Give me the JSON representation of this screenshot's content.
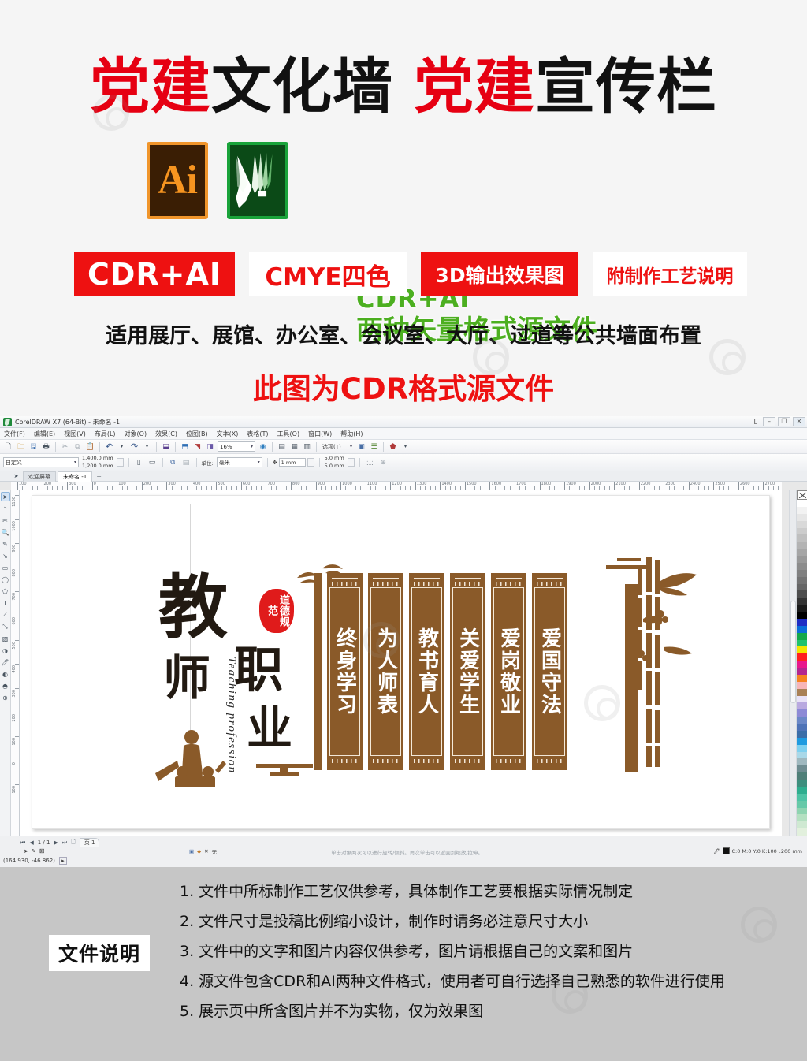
{
  "promo": {
    "title_parts": [
      {
        "text": "党建",
        "color": "#e60012"
      },
      {
        "text": "文化墙",
        "color": "#111111"
      },
      {
        "text": "党建",
        "color": "#e60012"
      },
      {
        "text": "宣传栏",
        "color": "#111111"
      }
    ],
    "ai_icon_label": "Ai",
    "cdr_icon_label": "CorelDRAW",
    "format_line1": "CDR+AI",
    "format_line2": "两种矢量格式源文件",
    "format_color": "#4caf20",
    "badges": [
      {
        "label": "CDR+AI",
        "style": "filled"
      },
      {
        "label": "CMYE四色",
        "style": "hollow"
      },
      {
        "label": "3D输出效果图",
        "style": "filled"
      },
      {
        "label": "附制作工艺说明",
        "style": "hollow"
      }
    ],
    "applies_text": "适用展厅、展馆、办公室、会议室、大厅、过道等公共墙面布置",
    "source_note": "此图为CDR格式源文件",
    "red": "#ee1111"
  },
  "coreldraw": {
    "window_title": "CorelDRAW X7 (64-Bit) - 未命名 -1",
    "user_label": "L",
    "win_buttons": [
      "–",
      "❐",
      "✕"
    ],
    "menu": [
      "文件(F)",
      "编辑(E)",
      "视图(V)",
      "布局(L)",
      "对象(O)",
      "效果(C)",
      "位图(B)",
      "文本(X)",
      "表格(T)",
      "工具(O)",
      "窗口(W)",
      "帮助(H)"
    ],
    "toolbar_icons": [
      "new-icon",
      "open-icon",
      "save-icon",
      "print-icon",
      "cut-icon",
      "copy-icon",
      "paste-icon",
      "undo-icon",
      "redo-icon",
      "import-icon",
      "export-icon",
      "publish-pdf-icon",
      "app-launch-icon"
    ],
    "zoom_level": "16%",
    "options_label": "选项(T)",
    "propbar": {
      "page_preset": "自定义",
      "page_width": "1,400.0 mm",
      "page_height": "1,200.0 mm",
      "units_label": "单位:",
      "units_value": "毫米",
      "nudge_value": "1 mm",
      "duplicate_x": "5.0 mm",
      "duplicate_y": "5.0 mm"
    },
    "tabs": [
      {
        "label": "欢迎屏幕",
        "active": false
      },
      {
        "label": "未命名 -1",
        "active": true
      }
    ],
    "tab_add": "+",
    "ruler_h_labels": [
      "100",
      "200",
      "300",
      "0",
      "100",
      "200",
      "300",
      "400",
      "500",
      "600",
      "700",
      "800",
      "900",
      "1000",
      "1100",
      "1200",
      "1300",
      "1400",
      "1500",
      "1600",
      "1700",
      "1800",
      "1900",
      "2000",
      "2100",
      "2200",
      "2300",
      "2400",
      "2500",
      "2600",
      "2700"
    ],
    "ruler_v_labels": [
      "1100",
      "1000",
      "900",
      "800",
      "700",
      "600",
      "500",
      "400",
      "300",
      "200",
      "100",
      "0",
      "100"
    ],
    "toolbox": [
      "pick-tool-icon",
      "shape-tool-icon",
      "crop-tool-icon",
      "zoom-tool-icon",
      "freehand-tool-icon",
      "artistic-media-icon",
      "rectangle-tool-icon",
      "ellipse-tool-icon",
      "polygon-tool-icon",
      "text-tool-icon",
      "parallel-dimension-icon",
      "straight-line-connector-icon",
      "drop-shadow-icon",
      "transparency-icon",
      "color-eyedropper-icon",
      "interactive-fill-icon",
      "smart-fill-icon",
      "add-tool-icon"
    ],
    "status": {
      "page_current": "1 / 1",
      "page_tab": "页 1",
      "coords": "(164.930, -46.862)",
      "hint": "单击对象两次可以进行旋转/倾斜。再次单击可以返回到缩放/拉伸。",
      "snap_label": "无",
      "fill_info": "C:0 M:0 Y:0 K:100",
      "outline_info": ".200 mm"
    },
    "palette_colors": [
      "#ffffff",
      "#f2f2f2",
      "#e6e6e6",
      "#d9d9d9",
      "#cccccc",
      "#bfbfbf",
      "#b3b3b3",
      "#a6a6a6",
      "#999999",
      "#8c8c8c",
      "#808080",
      "#737373",
      "#666666",
      "#4d4d4d",
      "#333333",
      "#1a1a1a",
      "#000000",
      "#1f2ec4",
      "#0b6ed8",
      "#14a84a",
      "#1fc36d",
      "#f2e500",
      "#ff1f1f",
      "#e8178c",
      "#b3268f",
      "#f58220",
      "#f7b5b8",
      "#a98156",
      "#e8e2f7",
      "#b9a9e0",
      "#8d8ad6",
      "#6b88c7",
      "#4e73b7",
      "#3b6ea8",
      "#1f9be0",
      "#7fd0ef",
      "#a9d8e8",
      "#9fb8bf",
      "#6e8c91",
      "#4f7f78",
      "#3d8f7e",
      "#2fae8f",
      "#4fc3a5",
      "#66c9a8",
      "#8fd4b1",
      "#b4e0c1",
      "#cfe9d2",
      "#e2f0dd"
    ]
  },
  "artwork": {
    "headline_chars": {
      "jiao": "教",
      "shi": "师",
      "zhi": "职",
      "ye": "业"
    },
    "seal_text": "道德规范",
    "english_vertical": "Teaching profession",
    "panels": [
      "终身学习",
      "为人师表",
      "教书育人",
      "关爱学生",
      "爱岗敬业",
      "爱国守法"
    ],
    "panel_color": "#8a5a29",
    "panel_text_color": "#ffffff"
  },
  "notes": {
    "label": "文件说明",
    "items": [
      "1. 文件中所标制作工艺仅供参考，具体制作工艺要根据实际情况制定",
      "2. 文件尺寸是投稿比例缩小设计，制作时请务必注意尺寸大小",
      "3. 文件中的文字和图片内容仅供参考，图片请根据自己的文案和图片",
      "4. 源文件包含CDR和AI两种文件格式，使用者可自行选择自己熟悉的软件进行使用",
      "5. 展示页中所含图片并不为实物，仅为效果图"
    ]
  }
}
